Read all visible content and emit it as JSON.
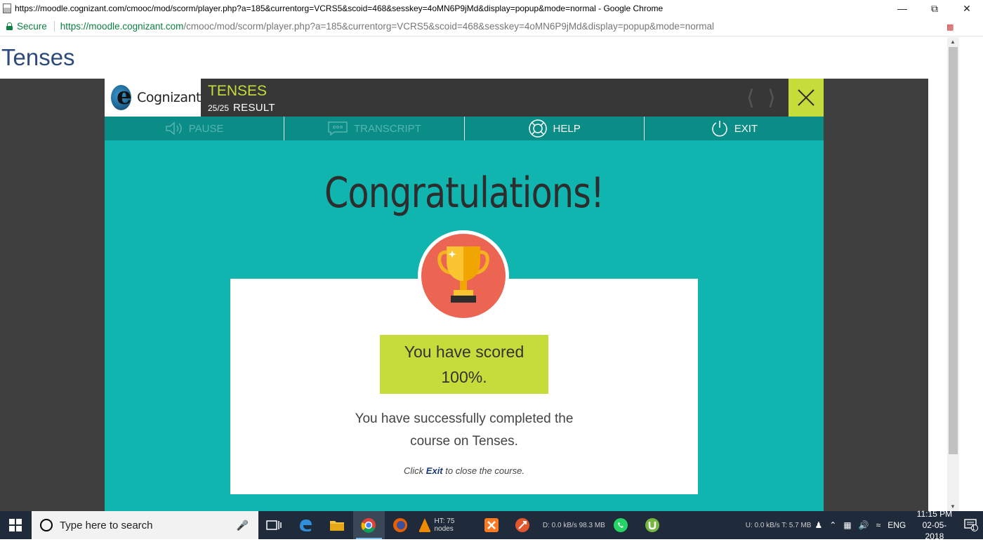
{
  "browser": {
    "window_title": "https://moodle.cognizant.com/cmooc/mod/scorm/player.php?a=185&currentorg=VCRS5&scoid=468&sesskey=4oMN6P9jMd&display=popup&mode=normal - Google Chrome",
    "secure_label": "Secure",
    "url_host": "https://moodle.cognizant.com",
    "url_path": "/cmooc/mod/scorm/player.php?a=185&currentorg=VCRS5&scoid=468&sesskey=4oMN6P9jMd&display=popup&mode=normal"
  },
  "page": {
    "heading": "Tenses"
  },
  "player": {
    "logo_text": "Cognizant",
    "course_title": "TENSES",
    "progress": "25/25",
    "section": "RESULT",
    "toolbar": {
      "pause": "PAUSE",
      "transcript": "TRANSCRIPT",
      "help": "HELP",
      "exit": "EXIT"
    },
    "result": {
      "headline": "Congratulations!",
      "score_line1": "You have scored",
      "score_line2": "100%.",
      "message_line1": "You have successfully completed the",
      "message_line2": "course on Tenses.",
      "hint_prefix": "Click ",
      "hint_link": "Exit",
      "hint_suffix": " to close the course."
    }
  },
  "taskbar": {
    "search_placeholder": "Type here to search",
    "firefox_label": "HT: 75 nodes",
    "network_text": "D: 0.0 kB/s  98.3 MB",
    "upload_text": "U: 0.0 kB/s  T: 5.7 MB",
    "language": "ENG",
    "time": "11:15 PM",
    "date": "02-05-2018",
    "notification_count": "1"
  },
  "colors": {
    "teal": "#10b5b0",
    "lime": "#c6dc3a",
    "coral": "#ec6552"
  }
}
